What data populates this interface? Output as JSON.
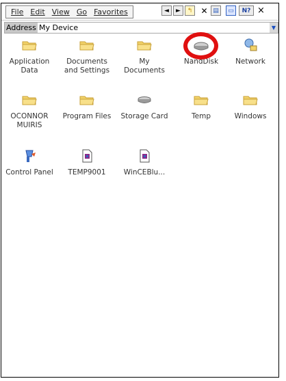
{
  "menu": {
    "items": [
      "File",
      "Edit",
      "View",
      "Go",
      "Favorites"
    ]
  },
  "toolbar": {
    "buttons": [
      {
        "name": "back-icon",
        "glyph": "◄"
      },
      {
        "name": "forward-icon",
        "glyph": "►"
      },
      {
        "name": "up-folder-icon",
        "glyph": "↰"
      },
      {
        "name": "delete-icon",
        "glyph": "✕"
      },
      {
        "name": "properties-icon",
        "glyph": "▤"
      },
      {
        "name": "view-mode-icon",
        "glyph": "▭"
      },
      {
        "name": "help-icon",
        "glyph": "?"
      },
      {
        "name": "close-icon",
        "glyph": "×"
      }
    ]
  },
  "address": {
    "label": "Address",
    "value": "My Device"
  },
  "items": [
    {
      "label": "Application Data",
      "icon": "folder-icon"
    },
    {
      "label": "Documents and Settings",
      "icon": "folder-icon"
    },
    {
      "label": "My Documents",
      "icon": "folder-icon"
    },
    {
      "label": "NandDisk",
      "icon": "disk-icon"
    },
    {
      "label": "Network",
      "icon": "network-icon"
    },
    {
      "label": "OCONNOR MUIRIS",
      "icon": "folder-icon"
    },
    {
      "label": "Program Files",
      "icon": "folder-icon"
    },
    {
      "label": "Storage Card",
      "icon": "disk-icon"
    },
    {
      "label": "Temp",
      "icon": "folder-icon"
    },
    {
      "label": "Windows",
      "icon": "folder-icon"
    },
    {
      "label": "Control Panel",
      "icon": "control-panel-icon"
    },
    {
      "label": "TEMP9001",
      "icon": "file-icon"
    },
    {
      "label": "WinCEBlu...",
      "icon": "file-icon"
    }
  ],
  "colors": {
    "folder": "#f2d36a",
    "highlight": "#e01010"
  }
}
